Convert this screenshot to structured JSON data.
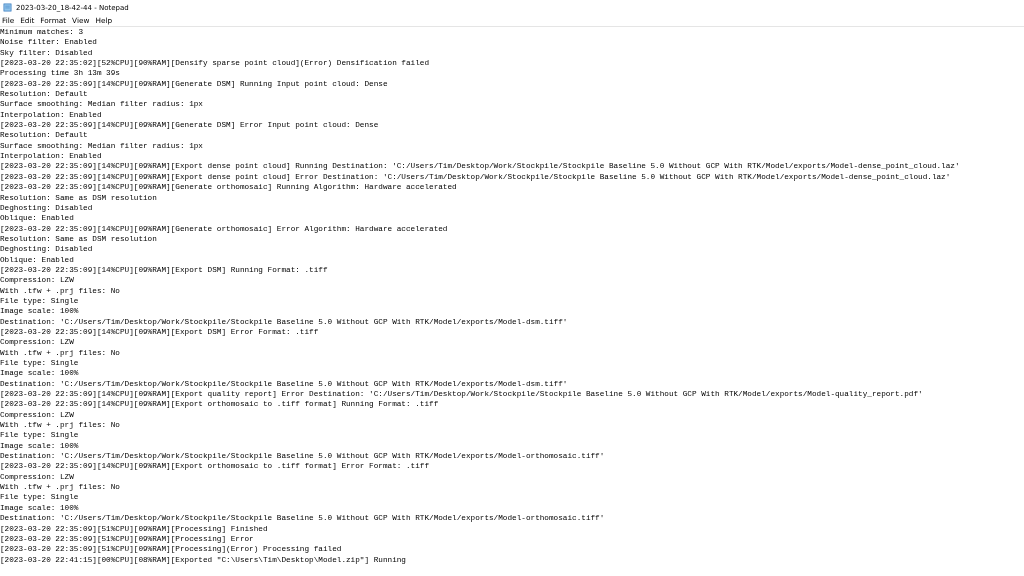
{
  "window": {
    "title": "2023-03-20_18-42-44 - Notepad"
  },
  "menu": [
    {
      "label": "File"
    },
    {
      "label": "Edit"
    },
    {
      "label": "Format"
    },
    {
      "label": "View"
    },
    {
      "label": "Help"
    }
  ],
  "lines": [
    "Minimum matches: 3",
    "Noise filter: Enabled",
    "Sky filter: Disabled",
    "[2023-03-20 22:35:02][52%CPU][90%RAM][Densify sparse point cloud](Error) Densification failed",
    "Processing time 3h 13m 39s",
    "[2023-03-20 22:35:09][14%CPU][09%RAM][Generate DSM] Running Input point cloud: Dense",
    "Resolution: Default",
    "Surface smoothing: Median filter radius: 1px",
    "Interpolation: Enabled",
    "[2023-03-20 22:35:09][14%CPU][09%RAM][Generate DSM] Error Input point cloud: Dense",
    "Resolution: Default",
    "Surface smoothing: Median filter radius: 1px",
    "Interpolation: Enabled",
    "[2023-03-20 22:35:09][14%CPU][09%RAM][Export dense point cloud] Running Destination: 'C:/Users/Tim/Desktop/Work/Stockpile/Stockpile Baseline 5.0 Without GCP With RTK/Model/exports/Model-dense_point_cloud.laz'",
    "[2023-03-20 22:35:09][14%CPU][09%RAM][Export dense point cloud] Error Destination: 'C:/Users/Tim/Desktop/Work/Stockpile/Stockpile Baseline 5.0 Without GCP With RTK/Model/exports/Model-dense_point_cloud.laz'",
    "[2023-03-20 22:35:09][14%CPU][09%RAM][Generate orthomosaic] Running Algorithm: Hardware accelerated",
    "Resolution: Same as DSM resolution",
    "Deghosting: Disabled",
    "Oblique: Enabled",
    "[2023-03-20 22:35:09][14%CPU][09%RAM][Generate orthomosaic] Error Algorithm: Hardware accelerated",
    "Resolution: Same as DSM resolution",
    "Deghosting: Disabled",
    "Oblique: Enabled",
    "[2023-03-20 22:35:09][14%CPU][09%RAM][Export DSM] Running Format: .tiff",
    "Compression: LZW",
    "With .tfw + .prj files: No",
    "File type: Single",
    "Image scale: 100%",
    "Destination: 'C:/Users/Tim/Desktop/Work/Stockpile/Stockpile Baseline 5.0 Without GCP With RTK/Model/exports/Model-dsm.tiff'",
    "[2023-03-20 22:35:09][14%CPU][09%RAM][Export DSM] Error Format: .tiff",
    "Compression: LZW",
    "With .tfw + .prj files: No",
    "File type: Single",
    "Image scale: 100%",
    "Destination: 'C:/Users/Tim/Desktop/Work/Stockpile/Stockpile Baseline 5.0 Without GCP With RTK/Model/exports/Model-dsm.tiff'",
    "[2023-03-20 22:35:09][14%CPU][09%RAM][Export quality report] Error Destination: 'C:/Users/Tim/Desktop/Work/Stockpile/Stockpile Baseline 5.0 Without GCP With RTK/Model/exports/Model-quality_report.pdf'",
    "[2023-03-20 22:35:09][14%CPU][09%RAM][Export orthomosaic to .tiff format] Running Format: .tiff",
    "Compression: LZW",
    "With .tfw + .prj files: No",
    "File type: Single",
    "Image scale: 100%",
    "Destination: 'C:/Users/Tim/Desktop/Work/Stockpile/Stockpile Baseline 5.0 Without GCP With RTK/Model/exports/Model-orthomosaic.tiff'",
    "[2023-03-20 22:35:09][14%CPU][09%RAM][Export orthomosaic to .tiff format] Error Format: .tiff",
    "Compression: LZW",
    "With .tfw + .prj files: No",
    "File type: Single",
    "Image scale: 100%",
    "Destination: 'C:/Users/Tim/Desktop/Work/Stockpile/Stockpile Baseline 5.0 Without GCP With RTK/Model/exports/Model-orthomosaic.tiff'",
    "[2023-03-20 22:35:09][51%CPU][09%RAM][Processing] Finished",
    "[2023-03-20 22:35:09][51%CPU][09%RAM][Processing] Error",
    "[2023-03-20 22:35:09][51%CPU][09%RAM][Processing](Error) Processing failed",
    "[2023-03-20 22:41:15][00%CPU][08%RAM][Exported \"C:\\Users\\Tim\\Desktop\\Model.zip\"] Running"
  ]
}
